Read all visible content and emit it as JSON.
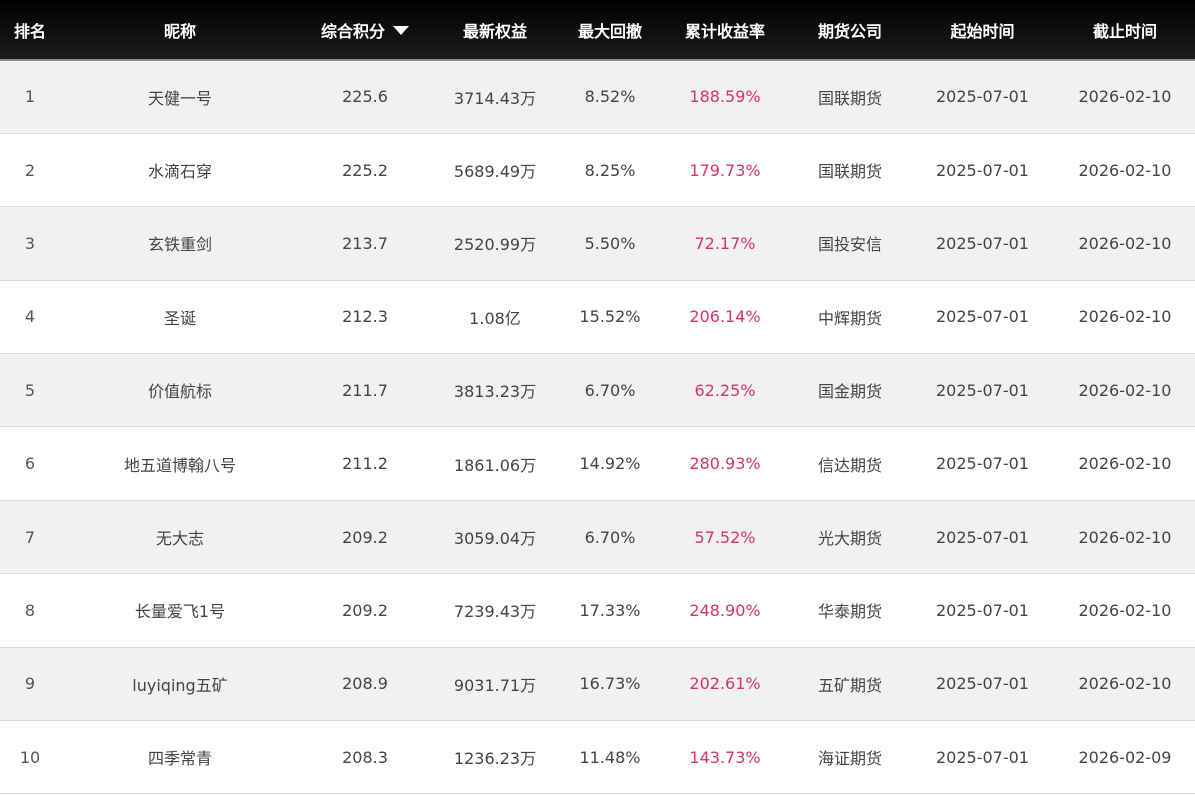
{
  "header": {
    "rank": "排名",
    "nickname": "昵称",
    "score": "综合积分",
    "equity": "最新权益",
    "drawdown": "最大回撤",
    "return": "累计收益率",
    "company": "期货公司",
    "start": "起始时间",
    "end": "截止时间"
  },
  "sort": {
    "column": "score",
    "direction": "desc",
    "icon": "caret-down-icon"
  },
  "colors": {
    "header_bg": "#0a0a0a",
    "return_text": "#d6336c",
    "row_alt": "#f1f1f1"
  },
  "rows": [
    {
      "rank": "1",
      "nickname": "天健一号",
      "score": "225.6",
      "equity": "3714.43万",
      "drawdown": "8.52%",
      "return": "188.59%",
      "company": "国联期货",
      "start": "2025-07-01",
      "end": "2026-02-10"
    },
    {
      "rank": "2",
      "nickname": "水滴石穿",
      "score": "225.2",
      "equity": "5689.49万",
      "drawdown": "8.25%",
      "return": "179.73%",
      "company": "国联期货",
      "start": "2025-07-01",
      "end": "2026-02-10"
    },
    {
      "rank": "3",
      "nickname": "玄铁重剑",
      "score": "213.7",
      "equity": "2520.99万",
      "drawdown": "5.50%",
      "return": "72.17%",
      "company": "国投安信",
      "start": "2025-07-01",
      "end": "2026-02-10"
    },
    {
      "rank": "4",
      "nickname": "圣诞",
      "score": "212.3",
      "equity": "1.08亿",
      "drawdown": "15.52%",
      "return": "206.14%",
      "company": "中辉期货",
      "start": "2025-07-01",
      "end": "2026-02-10"
    },
    {
      "rank": "5",
      "nickname": "价值航标",
      "score": "211.7",
      "equity": "3813.23万",
      "drawdown": "6.70%",
      "return": "62.25%",
      "company": "国金期货",
      "start": "2025-07-01",
      "end": "2026-02-10"
    },
    {
      "rank": "6",
      "nickname": "地五道博翰八号",
      "score": "211.2",
      "equity": "1861.06万",
      "drawdown": "14.92%",
      "return": "280.93%",
      "company": "信达期货",
      "start": "2025-07-01",
      "end": "2026-02-10"
    },
    {
      "rank": "7",
      "nickname": "无大志",
      "score": "209.2",
      "equity": "3059.04万",
      "drawdown": "6.70%",
      "return": "57.52%",
      "company": "光大期货",
      "start": "2025-07-01",
      "end": "2026-02-10"
    },
    {
      "rank": "8",
      "nickname": "长量爱飞1号",
      "score": "209.2",
      "equity": "7239.43万",
      "drawdown": "17.33%",
      "return": "248.90%",
      "company": "华泰期货",
      "start": "2025-07-01",
      "end": "2026-02-10"
    },
    {
      "rank": "9",
      "nickname": "luyiqing五矿",
      "score": "208.9",
      "equity": "9031.71万",
      "drawdown": "16.73%",
      "return": "202.61%",
      "company": "五矿期货",
      "start": "2025-07-01",
      "end": "2026-02-10"
    },
    {
      "rank": "10",
      "nickname": "四季常青",
      "score": "208.3",
      "equity": "1236.23万",
      "drawdown": "11.48%",
      "return": "143.73%",
      "company": "海证期货",
      "start": "2025-07-01",
      "end": "2026-02-09"
    }
  ]
}
